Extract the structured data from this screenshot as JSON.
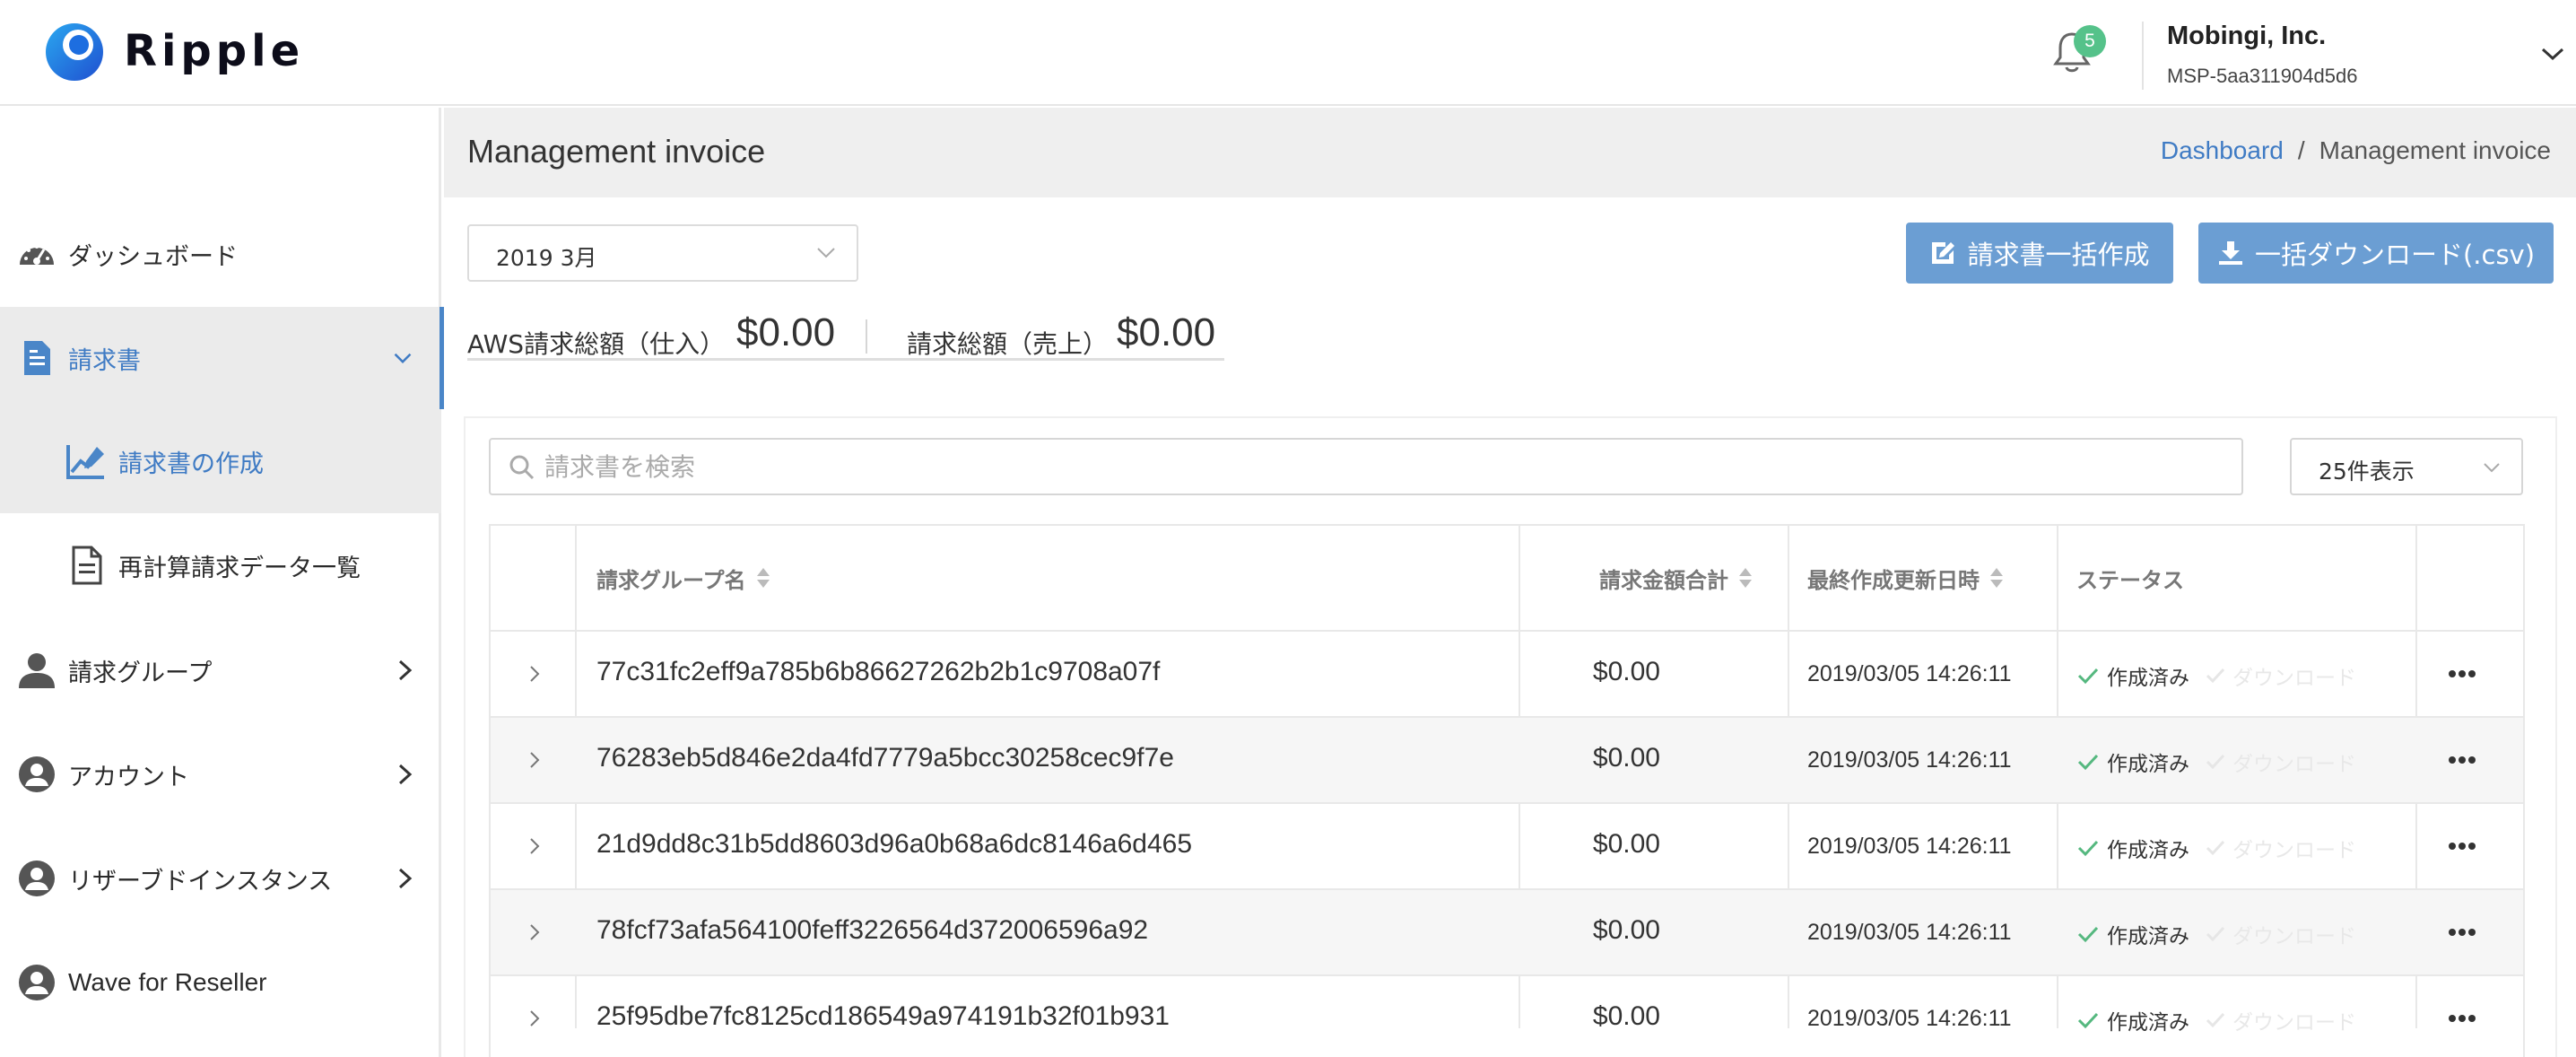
{
  "app": {
    "name": "Ripple"
  },
  "header": {
    "notification_count": "5",
    "org_name": "Mobingi, Inc.",
    "org_id": "MSP-5aa311904d5d6"
  },
  "sidebar": {
    "items": [
      {
        "label": "ダッシュボード",
        "icon": "dashboard-gauge-icon"
      },
      {
        "label": "請求書",
        "icon": "invoice-document-icon",
        "active": true,
        "expanded": true
      },
      {
        "label": "請求書の作成",
        "icon": "chart-pen-icon",
        "active": true
      },
      {
        "label": "再計算請求データ一覧",
        "icon": "document-icon"
      },
      {
        "label": "請求グループ",
        "icon": "user-icon"
      },
      {
        "label": "アカウント",
        "icon": "user-circle-icon"
      },
      {
        "label": "リザーブドインスタンス",
        "icon": "user-circle-icon"
      },
      {
        "label": "Wave for Reseller",
        "icon": "user-circle-icon"
      }
    ]
  },
  "page": {
    "title": "Management invoice",
    "breadcrumb": {
      "link": "Dashboard",
      "separator": "/",
      "current": "Management invoice"
    }
  },
  "toolbar": {
    "month": "2019 3月",
    "bulk_create_label": "請求書一括作成",
    "bulk_download_label": "一括ダウンロード(.csv)"
  },
  "totals": {
    "aws_label": "AWS請求総額（仕入）",
    "aws_value": "$0.00",
    "sales_label": "請求総額（売上）",
    "sales_value": "$0.00"
  },
  "search": {
    "placeholder": "請求書を検索"
  },
  "per_page": "25件表示",
  "table": {
    "columns": [
      "請求グループ名",
      "請求金額合計",
      "最終作成更新日時",
      "ステータス"
    ],
    "rows": [
      {
        "name": "77c31fc2eff9a785b6b86627262b2b1c9708a07f",
        "amount": "$0.00",
        "updated": "2019/03/05 14:26:11",
        "status": "作成済み",
        "download": "ダウンロード"
      },
      {
        "name": "76283eb5d846e2da4fd7779a5bcc30258cec9f7e",
        "amount": "$0.00",
        "updated": "2019/03/05 14:26:11",
        "status": "作成済み",
        "download": "ダウンロード"
      },
      {
        "name": "21d9dd8c31b5dd8603d96a0b68a6dc8146a6d465",
        "amount": "$0.00",
        "updated": "2019/03/05 14:26:11",
        "status": "作成済み",
        "download": "ダウンロード"
      },
      {
        "name": "78fcf73afa564100feff3226564d372006596a92",
        "amount": "$0.00",
        "updated": "2019/03/05 14:26:11",
        "status": "作成済み",
        "download": "ダウンロード"
      },
      {
        "name": "25f95dbe7fc8125cd186549a974191b32f01b931",
        "amount": "$0.00",
        "updated": "2019/03/05 14:26:11",
        "status": "作成済み",
        "download": "ダウンロード"
      }
    ]
  },
  "colors": {
    "accent": "#3f7bc4",
    "button": "#6b9ed3",
    "badge": "#55c28a",
    "status_ok": "#55b87f"
  }
}
